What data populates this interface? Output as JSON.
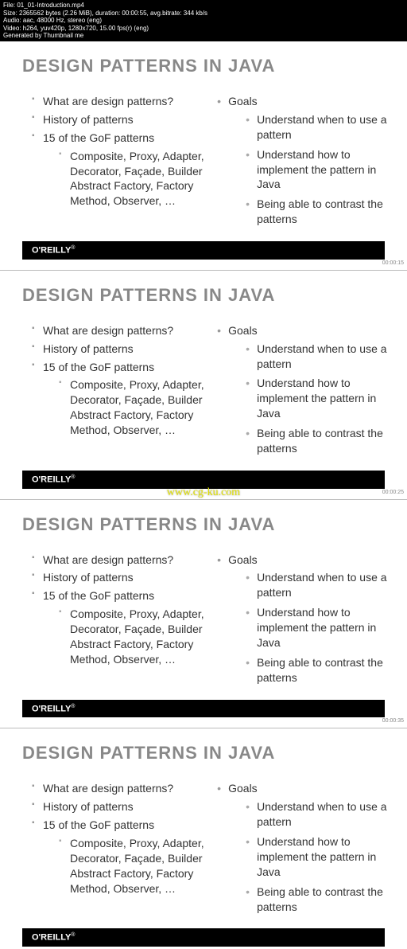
{
  "header": {
    "line1": "File: 01_01-Introduction.mp4",
    "line2": "Size: 2365562 bytes (2.26 MiB), duration: 00:00:55, avg.bitrate: 344 kb/s",
    "line3": "Audio: aac, 48000 Hz, stereo (eng)",
    "line4": "Video: h264, yuv420p, 1280x720, 15.00 fps(r) (eng)",
    "line5": "Generated by Thumbnail me"
  },
  "slide": {
    "title": "DESIGN PATTERNS IN JAVA",
    "left": {
      "items": [
        "What are design patterns?",
        "History of patterns",
        "15 of the GoF patterns"
      ],
      "subitem": "Composite, Proxy, Adapter, Decorator, Façade, Builder Abstract Factory, Factory Method, Observer, …"
    },
    "right": {
      "main": "Goals",
      "subs": [
        "Understand when to use a pattern",
        "Understand how to implement the pattern in Java",
        "Being able to contrast the patterns"
      ]
    },
    "footer": "O'REILLY"
  },
  "timestamps": [
    "00:00:15",
    "00:00:25",
    "00:00:35"
  ],
  "watermark": "www.cg-ku.com"
}
